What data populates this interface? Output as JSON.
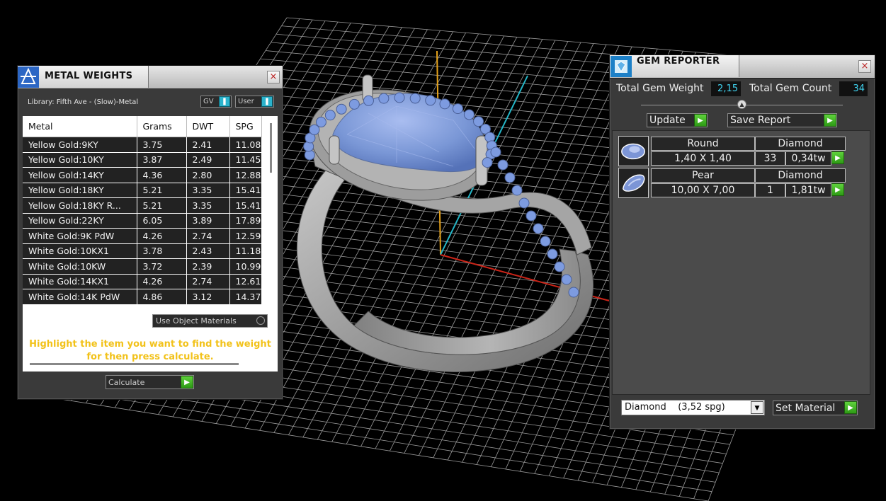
{
  "metal_weights": {
    "title": "METAL WEIGHTS",
    "close_label": "×",
    "library_label": "Library: Fifth Ave - (Slow)-Metal",
    "gv_label": "GV",
    "user_label": "User",
    "columns": [
      "Metal",
      "Grams",
      "DWT",
      "SPG"
    ],
    "rows": [
      [
        "Yellow Gold:9KY",
        "3.75",
        "2.41",
        "11.08"
      ],
      [
        "Yellow Gold:10KY",
        "3.87",
        "2.49",
        "11.45"
      ],
      [
        "Yellow Gold:14KY",
        "4.36",
        "2.80",
        "12.88"
      ],
      [
        "Yellow Gold:18KY",
        "5.21",
        "3.35",
        "15.41"
      ],
      [
        "Yellow Gold:18KY R...",
        "5.21",
        "3.35",
        "15.41"
      ],
      [
        "Yellow Gold:22KY",
        "6.05",
        "3.89",
        "17.89"
      ],
      [
        "White Gold:9K PdW",
        "4.26",
        "2.74",
        "12.59"
      ],
      [
        "White Gold:10KX1",
        "3.78",
        "2.43",
        "11.18"
      ],
      [
        "White Gold:10KW",
        "3.72",
        "2.39",
        "10.99"
      ],
      [
        "White Gold:14KX1",
        "4.26",
        "2.74",
        "12.61"
      ],
      [
        "White Gold:14K PdW",
        "4.86",
        "3.12",
        "14.37"
      ]
    ],
    "use_object_materials_label": "Use Object Materials",
    "hint": "Highlight the item you want to find the weight for then press calculate.",
    "calculate_label": "Calculate"
  },
  "gem_reporter": {
    "title": "GEM REPORTER",
    "close_label": "×",
    "total_weight_label": "Total Gem Weight",
    "total_weight_value": "2,15",
    "total_count_label": "Total Gem Count",
    "total_count_value": "34",
    "update_label": "Update",
    "save_report_label": "Save Report",
    "gems": [
      {
        "shape": "Round",
        "material": "Diamond",
        "size": "1,40 X 1,40",
        "count": "33",
        "weight": "0,34tw"
      },
      {
        "shape": "Pear",
        "material": "Diamond",
        "size": "10,00 X 7,00",
        "count": "1",
        "weight": "1,81tw"
      }
    ],
    "material_select": "Diamond    (3,52 spg)",
    "set_material_label": "Set Material"
  },
  "icons": {
    "metal_app": "metal-weights-icon",
    "gem_app": "gem-reporter-icon",
    "run": "play-arrow-icon"
  },
  "colors": {
    "accent_cyan": "#40d3f0",
    "hint_yellow": "#f2c21a",
    "button_green": "#3cb81c",
    "gem_blue": "#7a97d6"
  }
}
